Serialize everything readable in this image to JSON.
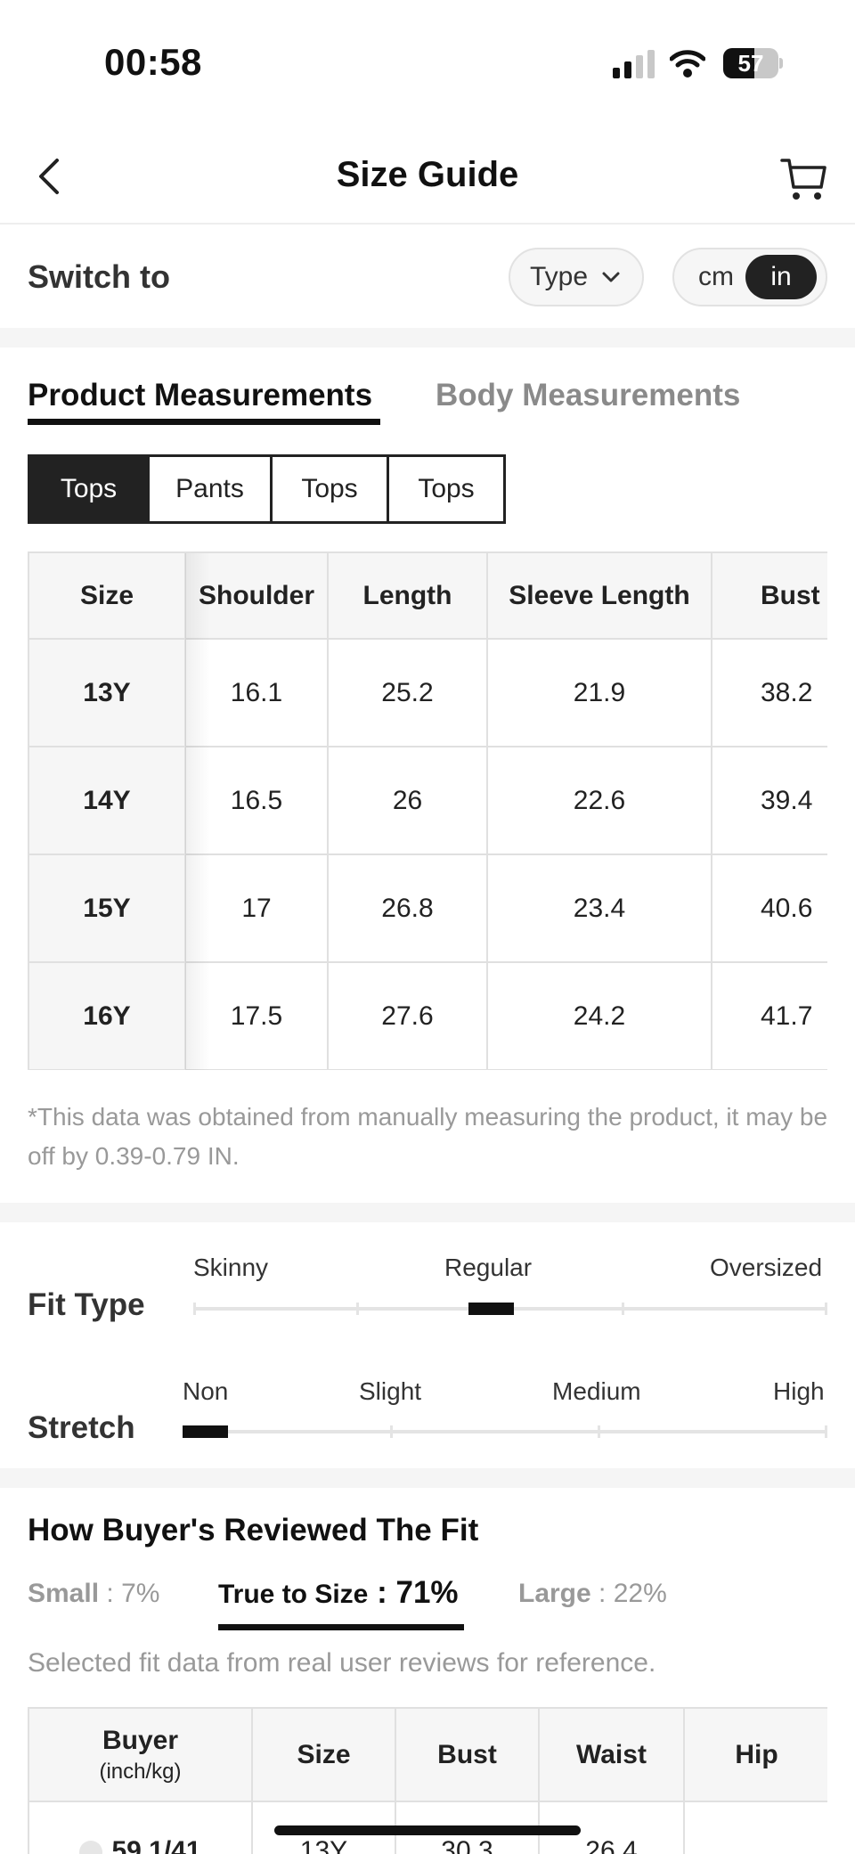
{
  "status_bar": {
    "time": "00:58",
    "battery": "57",
    "battery_level": 0.57
  },
  "header": {
    "title": "Size Guide"
  },
  "switch": {
    "label": "Switch to",
    "type_label": "Type",
    "units": [
      "cm",
      "in"
    ],
    "selected_unit": "in"
  },
  "tabs": [
    {
      "label": "Product Measurements",
      "active": true
    },
    {
      "label": "Body Measurements",
      "active": false
    }
  ],
  "segments": [
    "Tops",
    "Pants",
    "Tops",
    "Tops"
  ],
  "measurements": {
    "headers": [
      "Size",
      "Shoulder",
      "Length",
      "Sleeve Length",
      "Bust"
    ],
    "rows": [
      [
        "13Y",
        "16.1",
        "25.2",
        "21.9",
        "38.2"
      ],
      [
        "14Y",
        "16.5",
        "26",
        "22.6",
        "39.4"
      ],
      [
        "15Y",
        "17",
        "26.8",
        "23.4",
        "40.6"
      ],
      [
        "16Y",
        "17.5",
        "27.6",
        "24.2",
        "41.7"
      ]
    ]
  },
  "note": "*This data was obtained from manually measuring the product, it may be off by 0.39-0.79 IN.",
  "fit_type": {
    "title": "Fit Type",
    "labels": [
      "Skinny",
      "Regular",
      "Oversized"
    ],
    "value": "Regular"
  },
  "stretch": {
    "title": "Stretch",
    "labels": [
      "Non",
      "Slight",
      "Medium",
      "High"
    ],
    "value": "Non"
  },
  "reviews": {
    "title": "How Buyer's Reviewed The Fit",
    "small": {
      "label": "Small",
      "sep": " : ",
      "pct": "7%"
    },
    "true_to_size": {
      "label": "True to Size",
      "sep": " : ",
      "pct": "71%"
    },
    "large": {
      "label": "Large",
      "sep": " : ",
      "pct": "22%"
    },
    "note": "Selected fit data from real user reviews for reference.",
    "table": {
      "headers": {
        "buyer": "Buyer",
        "buyer_unit": "(inch/kg)",
        "size": "Size",
        "bust": "Bust",
        "waist": "Waist",
        "hip": "Hip"
      },
      "rows": [
        {
          "buyer": "59.1/41",
          "size": "13Y",
          "bust": "30.3",
          "waist": "26.4",
          "hip": ""
        }
      ]
    }
  }
}
